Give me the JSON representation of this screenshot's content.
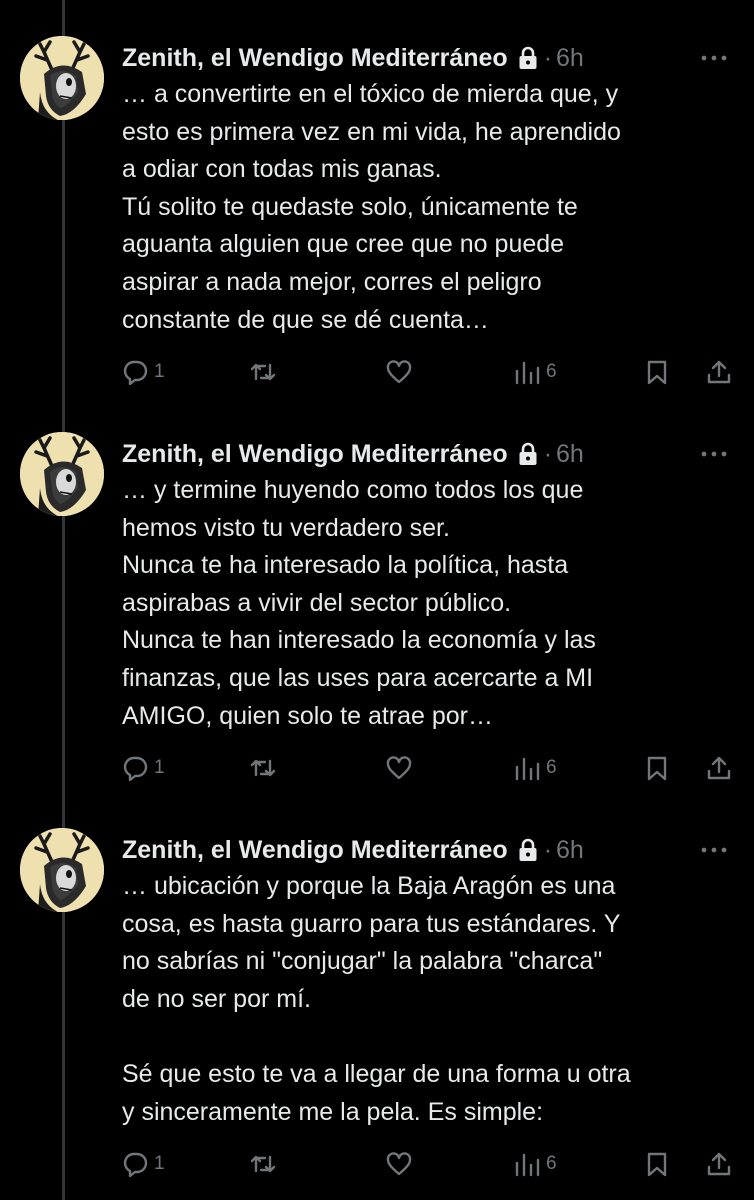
{
  "tweets": [
    {
      "author": "Zenith, el Wendigo Mediterráneo",
      "separator": "·",
      "time": "6h",
      "lines": [
        "… a convertirte en el tóxico de mierda que, y",
        "esto es primera vez en mi vida, he aprendido",
        "a odiar con todas mis ganas.",
        "Tú solito te quedaste solo, únicamente te",
        "aguanta alguien que cree que no puede",
        "aspirar a nada mejor, corres el peligro",
        "constante de que se dé cuenta…"
      ],
      "replies": "1",
      "views": "6"
    },
    {
      "author": "Zenith, el Wendigo Mediterráneo",
      "separator": "·",
      "time": "6h",
      "lines": [
        "… y termine huyendo como todos los que",
        "hemos visto tu verdadero ser.",
        "Nunca te ha interesado la política, hasta",
        "aspirabas a vivir del sector público.",
        "Nunca te han interesado la economía y las",
        "finanzas, que las uses para acercarte a MI",
        "AMIGO, quien solo te atrae por…"
      ],
      "replies": "1",
      "views": "6"
    },
    {
      "author": "Zenith, el Wendigo Mediterráneo",
      "separator": "·",
      "time": "6h",
      "lines": [
        "… ubicación y porque la Baja Aragón es una",
        "cosa, es hasta guarro para tus estándares. Y",
        "no sabrías ni \"conjugar\" la palabra \"charca\"",
        "de no ser por mí.",
        "",
        "Sé que esto te va a llegar de una forma u otra",
        "y sinceramente me la pela. Es simple:"
      ],
      "replies": "1",
      "views": "6"
    }
  ],
  "icons": {
    "avatar": "antlered-wendigo-avatar",
    "lock": "lock-icon",
    "more": "more-icon",
    "reply": "reply-icon",
    "retweet": "retweet-icon",
    "like": "heart-icon",
    "views": "views-chart-icon",
    "bookmark": "bookmark-icon",
    "share": "share-icon"
  },
  "colors": {
    "background": "#000000",
    "text": "#e7e9ea",
    "muted": "#71767b",
    "thread_line": "#333639"
  }
}
